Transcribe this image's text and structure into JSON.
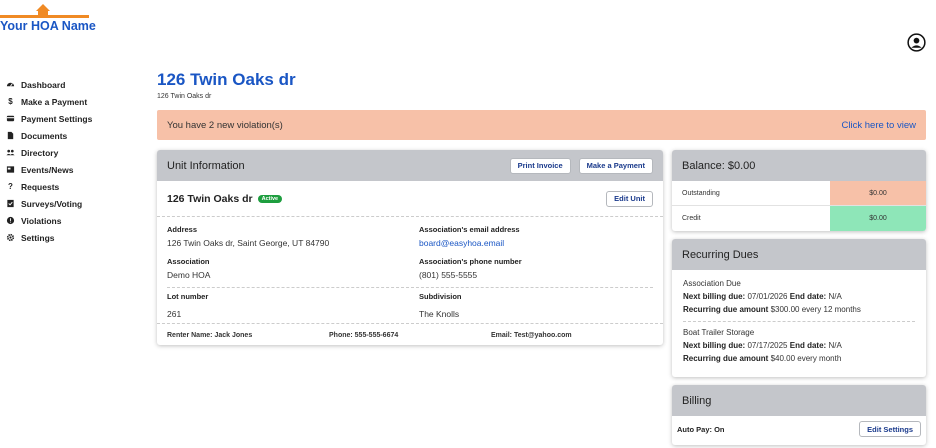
{
  "brand": {
    "logo_text": "Your HOA Name",
    "accent": "#f08a24",
    "primary": "#1a56c4"
  },
  "sidebar": {
    "items": [
      {
        "label": "Dashboard",
        "icon": "dashboard-icon"
      },
      {
        "label": "Make a Payment",
        "icon": "dollar-icon"
      },
      {
        "label": "Payment Settings",
        "icon": "card-icon"
      },
      {
        "label": "Documents",
        "icon": "document-icon"
      },
      {
        "label": "Directory",
        "icon": "people-icon"
      },
      {
        "label": "Events/News",
        "icon": "newspaper-icon"
      },
      {
        "label": "Requests",
        "icon": "question-icon"
      },
      {
        "label": "Surveys/Voting",
        "icon": "ballot-icon"
      },
      {
        "label": "Violations",
        "icon": "alert-icon"
      },
      {
        "label": "Settings",
        "icon": "gear-icon"
      }
    ]
  },
  "page": {
    "title": "126 Twin Oaks dr",
    "subtitle": "126 Twin Oaks dr"
  },
  "banner": {
    "message": "You have 2 new violation(s)",
    "link": "Click here to view",
    "color": "#f7c1a8"
  },
  "unit": {
    "header": "Unit Information",
    "print_btn": "Print Invoice",
    "pay_btn": "Make a Payment",
    "name": "126 Twin Oaks dr",
    "status": "Active",
    "edit_btn": "Edit Unit",
    "address_label": "Address",
    "address": "126 Twin Oaks dr, Saint George, UT 84790",
    "email_label": "Association's email address",
    "email": "board@easyhoa.email",
    "association_label": "Association",
    "association": "Demo HOA",
    "phone_label": "Association's phone number",
    "phone": "(801) 555-5555",
    "lot_label": "Lot number",
    "lot": "261",
    "subdivision_label": "Subdivision",
    "subdivision": "The Knolls",
    "renter_name": "Renter Name: Jack Jones",
    "renter_phone": "Phone: 555-555-6674",
    "renter_email": "Email: Test@yahoo.com"
  },
  "balance": {
    "header": "Balance: $0.00",
    "outstanding_label": "Outstanding",
    "outstanding": "$0.00",
    "credit_label": "Credit",
    "credit": "$0.00",
    "outstanding_color": "#f7c1a8",
    "credit_color": "#8ee6b8"
  },
  "dues": {
    "header": "Recurring Dues",
    "items": [
      {
        "name": "Association Due",
        "next_label": "Next billing due:",
        "next": "07/01/2026",
        "end_label": "End date:",
        "end": "N/A",
        "amount_label": "Recurring due amount",
        "amount": "$300.00 every 12 months"
      },
      {
        "name": "Boat Trailer Storage",
        "next_label": "Next billing due:",
        "next": "07/17/2025",
        "end_label": "End date:",
        "end": "N/A",
        "amount_label": "Recurring due amount",
        "amount": "$40.00 every month"
      }
    ]
  },
  "billing": {
    "header": "Billing",
    "autopay": "Auto Pay: On",
    "edit_btn": "Edit Settings"
  }
}
